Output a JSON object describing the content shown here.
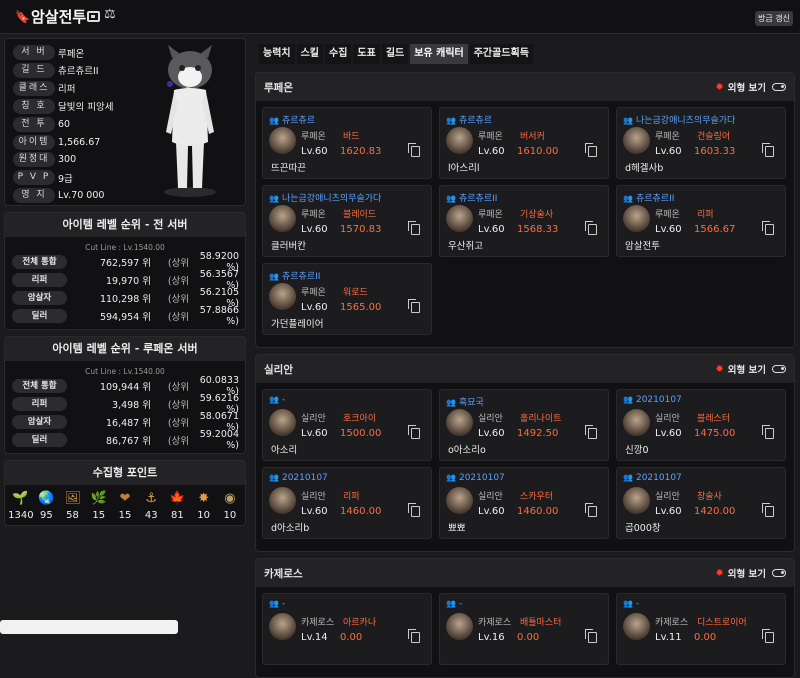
{
  "header": {
    "title": "암살전투",
    "refresh_label": "방금 갱신"
  },
  "profile": {
    "rows": [
      {
        "label": "서 버",
        "value": "루페온"
      },
      {
        "label": "길 드",
        "value": "츄르츄르II"
      },
      {
        "label": "클래스",
        "value": "리퍼"
      },
      {
        "label": "칭 호",
        "value": "달빛의 피앙세"
      },
      {
        "label": "전 투",
        "value": "60"
      },
      {
        "label": "아이템",
        "value": "1,566.67"
      },
      {
        "label": "원정대",
        "value": "300"
      },
      {
        "label": "P V P",
        "value": "9급"
      },
      {
        "label": "영 지",
        "value": "Lv.70 000"
      }
    ]
  },
  "ranking_all": {
    "title": "아이템 레벨 순위 - 전 서버",
    "cutline": "Cut Line : Lv.1540.00",
    "rows": [
      {
        "label": "전체 통합",
        "rank": "762,597 위",
        "sub": "(상위",
        "pct": "58.9200 %)"
      },
      {
        "label": "리퍼",
        "rank": "19,970 위",
        "sub": "(상위",
        "pct": "56.3567 %)"
      },
      {
        "label": "암살자",
        "rank": "110,298 위",
        "sub": "(상위",
        "pct": "56.2105 %)"
      },
      {
        "label": "딜러",
        "rank": "594,954 위",
        "sub": "(상위",
        "pct": "57.8866 %)"
      }
    ]
  },
  "ranking_server": {
    "title": "아이템 레벨 순위 - 루페온 서버",
    "cutline": "Cut Line : Lv.1540.00",
    "rows": [
      {
        "label": "전체 통합",
        "rank": "109,944 위",
        "sub": "(상위",
        "pct": "60.0833 %)"
      },
      {
        "label": "리퍼",
        "rank": "3,498 위",
        "sub": "(상위",
        "pct": "59.6216 %)"
      },
      {
        "label": "암살자",
        "rank": "16,487 위",
        "sub": "(상위",
        "pct": "58.0671 %)"
      },
      {
        "label": "딜러",
        "rank": "86,767 위",
        "sub": "(상위",
        "pct": "59.2004 %)"
      }
    ]
  },
  "collect": {
    "title": "수집형 포인트",
    "items": [
      {
        "icon": "seed-icon",
        "glyph": "🌱",
        "count": "1340"
      },
      {
        "icon": "island-heart-icon",
        "glyph": "🌏",
        "count": "95"
      },
      {
        "icon": "artwork-icon",
        "glyph": "🖼",
        "count": "58"
      },
      {
        "icon": "mokoko-icon",
        "glyph": "🌿",
        "count": "15"
      },
      {
        "icon": "giant-heart-icon",
        "glyph": "❤",
        "count": "15"
      },
      {
        "icon": "sea-bounty-icon",
        "glyph": "⚓",
        "count": "43"
      },
      {
        "icon": "world-tree-leaf-icon",
        "glyph": "🍁",
        "count": "81"
      },
      {
        "icon": "orpheus-star-icon",
        "glyph": "✸",
        "count": "10"
      },
      {
        "icon": "ignea-token-icon",
        "glyph": "◉",
        "count": "10"
      }
    ]
  },
  "tabs": [
    {
      "label": "능력치"
    },
    {
      "label": "스킬"
    },
    {
      "label": "수집"
    },
    {
      "label": "도표"
    },
    {
      "label": "길드"
    },
    {
      "label": "보유 캐릭터"
    },
    {
      "label": "주간골드획득"
    }
  ],
  "appear_label": "외형 보기",
  "servers": [
    {
      "name": "루페온",
      "characters": [
        {
          "guild": "츄르츄르",
          "server": "루페온",
          "class": "바드",
          "level": "Lv.60",
          "ilvl": "1620.83",
          "name": "뜨끈따끈"
        },
        {
          "guild": "츄르츄르",
          "server": "루페온",
          "class": "버서커",
          "level": "Lv.60",
          "ilvl": "1610.00",
          "name": "l아스리l"
        },
        {
          "guild": "나는금강애니츠의무슬가다",
          "server": "루페온",
          "class": "건슬링어",
          "level": "Lv.60",
          "ilvl": "1603.33",
          "name": "d헤겔사b"
        },
        {
          "guild": "나는금강애니츠의무슬가다",
          "server": "루페온",
          "class": "블레이드",
          "level": "Lv.60",
          "ilvl": "1570.83",
          "name": "클러버칸"
        },
        {
          "guild": "츄르츄르II",
          "server": "루페온",
          "class": "기상술사",
          "level": "Lv.60",
          "ilvl": "1568.33",
          "name": "우산쥐고"
        },
        {
          "guild": "츄르츄르II",
          "server": "루페온",
          "class": "리퍼",
          "level": "Lv.60",
          "ilvl": "1566.67",
          "name": "암살전투"
        },
        {
          "guild": "츄르츄르II",
          "server": "루페온",
          "class": "워로드",
          "level": "Lv.60",
          "ilvl": "1565.00",
          "name": "가던플레이어"
        }
      ]
    },
    {
      "name": "실리안",
      "characters": [
        {
          "guild": "-",
          "server": "실리안",
          "class": "호크아이",
          "level": "Lv.60",
          "ilvl": "1500.00",
          "name": "아소리"
        },
        {
          "guild": "흑묘국",
          "server": "실리안",
          "class": "홀리나이트",
          "level": "Lv.60",
          "ilvl": "1492.50",
          "name": "o아소리o"
        },
        {
          "guild": "20210107",
          "server": "실리안",
          "class": "블레스터",
          "level": "Lv.60",
          "ilvl": "1475.00",
          "name": "신깡0"
        },
        {
          "guild": "20210107",
          "server": "실리안",
          "class": "리퍼",
          "level": "Lv.60",
          "ilvl": "1460.00",
          "name": "d아소리b"
        },
        {
          "guild": "20210107",
          "server": "실리안",
          "class": "스카우터",
          "level": "Lv.60",
          "ilvl": "1460.00",
          "name": "뾰뾰"
        },
        {
          "guild": "20210107",
          "server": "실리안",
          "class": "창술사",
          "level": "Lv.60",
          "ilvl": "1420.00",
          "name": "곱000창"
        }
      ]
    },
    {
      "name": "카제로스",
      "characters": [
        {
          "guild": "-",
          "server": "카제로스",
          "class": "아르카나",
          "level": "Lv.14",
          "ilvl": "0.00",
          "name": ""
        },
        {
          "guild": "-",
          "server": "카제로스",
          "class": "배틀마스터",
          "level": "Lv.16",
          "ilvl": "0.00",
          "name": ""
        },
        {
          "guild": "-",
          "server": "카제로스",
          "class": "디스트로이어",
          "level": "Lv.11",
          "ilvl": "0.00",
          "name": ""
        }
      ]
    }
  ],
  "colors": {
    "accent_orange": "#ff6a3c",
    "guild_blue": "#5aa0ff",
    "appear_red": "#ff3b2b"
  }
}
